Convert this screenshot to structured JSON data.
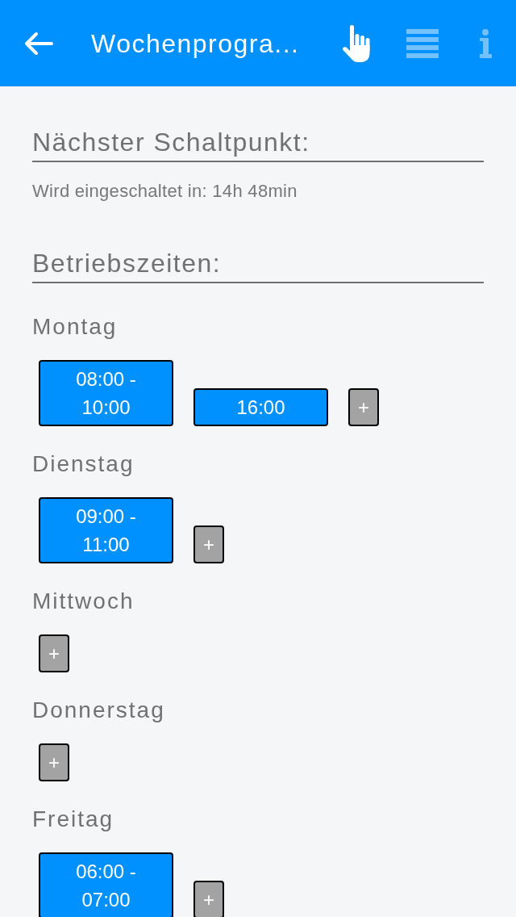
{
  "header": {
    "title": "Wochenprogra...",
    "actions": [
      {
        "selected": true
      },
      {
        "selected": false
      },
      {
        "selected": false
      }
    ]
  },
  "next_switch": {
    "heading": "Nächster Schaltpunkt:",
    "text": "Wird eingeschaltet in: 14h 48min"
  },
  "schedule": {
    "heading": "Betriebszeiten:",
    "days": [
      {
        "name": "Montag",
        "slots": [
          "08:00 - 10:00",
          "16:00"
        ],
        "add_button": "+"
      },
      {
        "name": "Dienstag",
        "slots": [
          "09:00 - 11:00"
        ],
        "add_button": "+"
      },
      {
        "name": "Mittwoch",
        "add_button": "+"
      },
      {
        "name": "Donnerstag",
        "add_button": "+"
      },
      {
        "name": "Freitag",
        "slots": [
          "06:00 - 07:00"
        ],
        "add_button": "+"
      }
    ]
  }
}
